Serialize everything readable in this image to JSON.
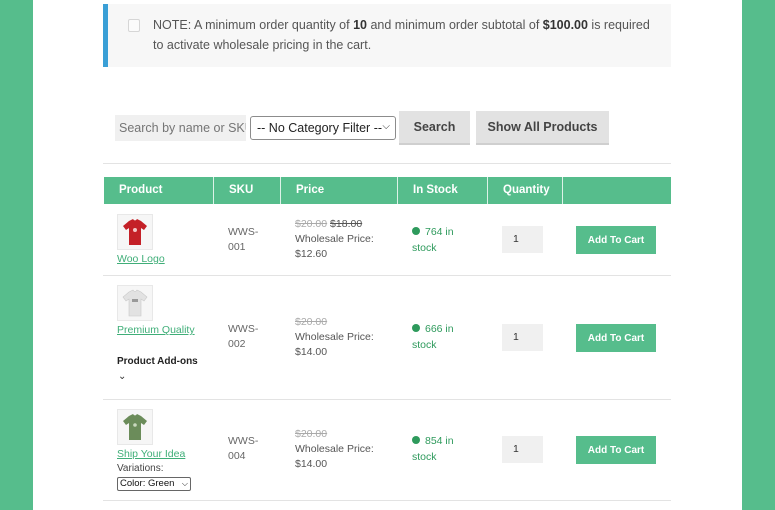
{
  "notice": {
    "part1": "NOTE: A minimum order quantity of ",
    "min_qty": "10",
    "part2": " and minimum order subtotal of ",
    "min_subtotal": "$100.00",
    "part3": " is required to activate wholesale pricing in the cart."
  },
  "toolbar": {
    "search_placeholder": "Search by name or SKU",
    "category_filter": "-- No Category Filter --",
    "search_label": "Search",
    "show_all_label": "Show All Products"
  },
  "table": {
    "headers": [
      "Product",
      "SKU",
      "Price",
      "In Stock",
      "Quantity",
      ""
    ],
    "rows": [
      {
        "name": "Woo Logo",
        "sku_line1": "WWS-",
        "sku_line2": "001",
        "original_price": "$20.00",
        "sale_price": "$18.00",
        "wholesale_label": "Wholesale Price:",
        "wholesale_price": "$12.60",
        "stock_line1": "764 in",
        "stock_line2": "stock",
        "quantity": "1",
        "cart_label": "Add To Cart",
        "shirt_color": "#c42027"
      },
      {
        "name": "Premium Quality",
        "sku_line1": "WWS-",
        "sku_line2": "002",
        "original_price": "$20.00",
        "wholesale_label": "Wholesale Price:",
        "wholesale_price": "$14.00",
        "stock_line1": "666 in",
        "stock_line2": "stock",
        "quantity": "1",
        "cart_label": "Add To Cart",
        "addons_label": "Product Add-ons",
        "shirt_color": "#e8e8e8"
      },
      {
        "name": "Ship Your Idea",
        "sku_line1": "WWS-",
        "sku_line2": "004",
        "original_price": "$20.00",
        "wholesale_label": "Wholesale Price:",
        "wholesale_price": "$14.00",
        "stock_line1": "854 in",
        "stock_line2": "stock",
        "quantity": "1",
        "cart_label": "Add To Cart",
        "variations_label": "Variations:",
        "variation_value": "Color: Green",
        "shirt_color": "#6b8c5a"
      }
    ]
  },
  "colors": {
    "accent": "#56bd8c",
    "notice_border": "#3a9fd6",
    "stock_green": "#2e9a5c"
  }
}
